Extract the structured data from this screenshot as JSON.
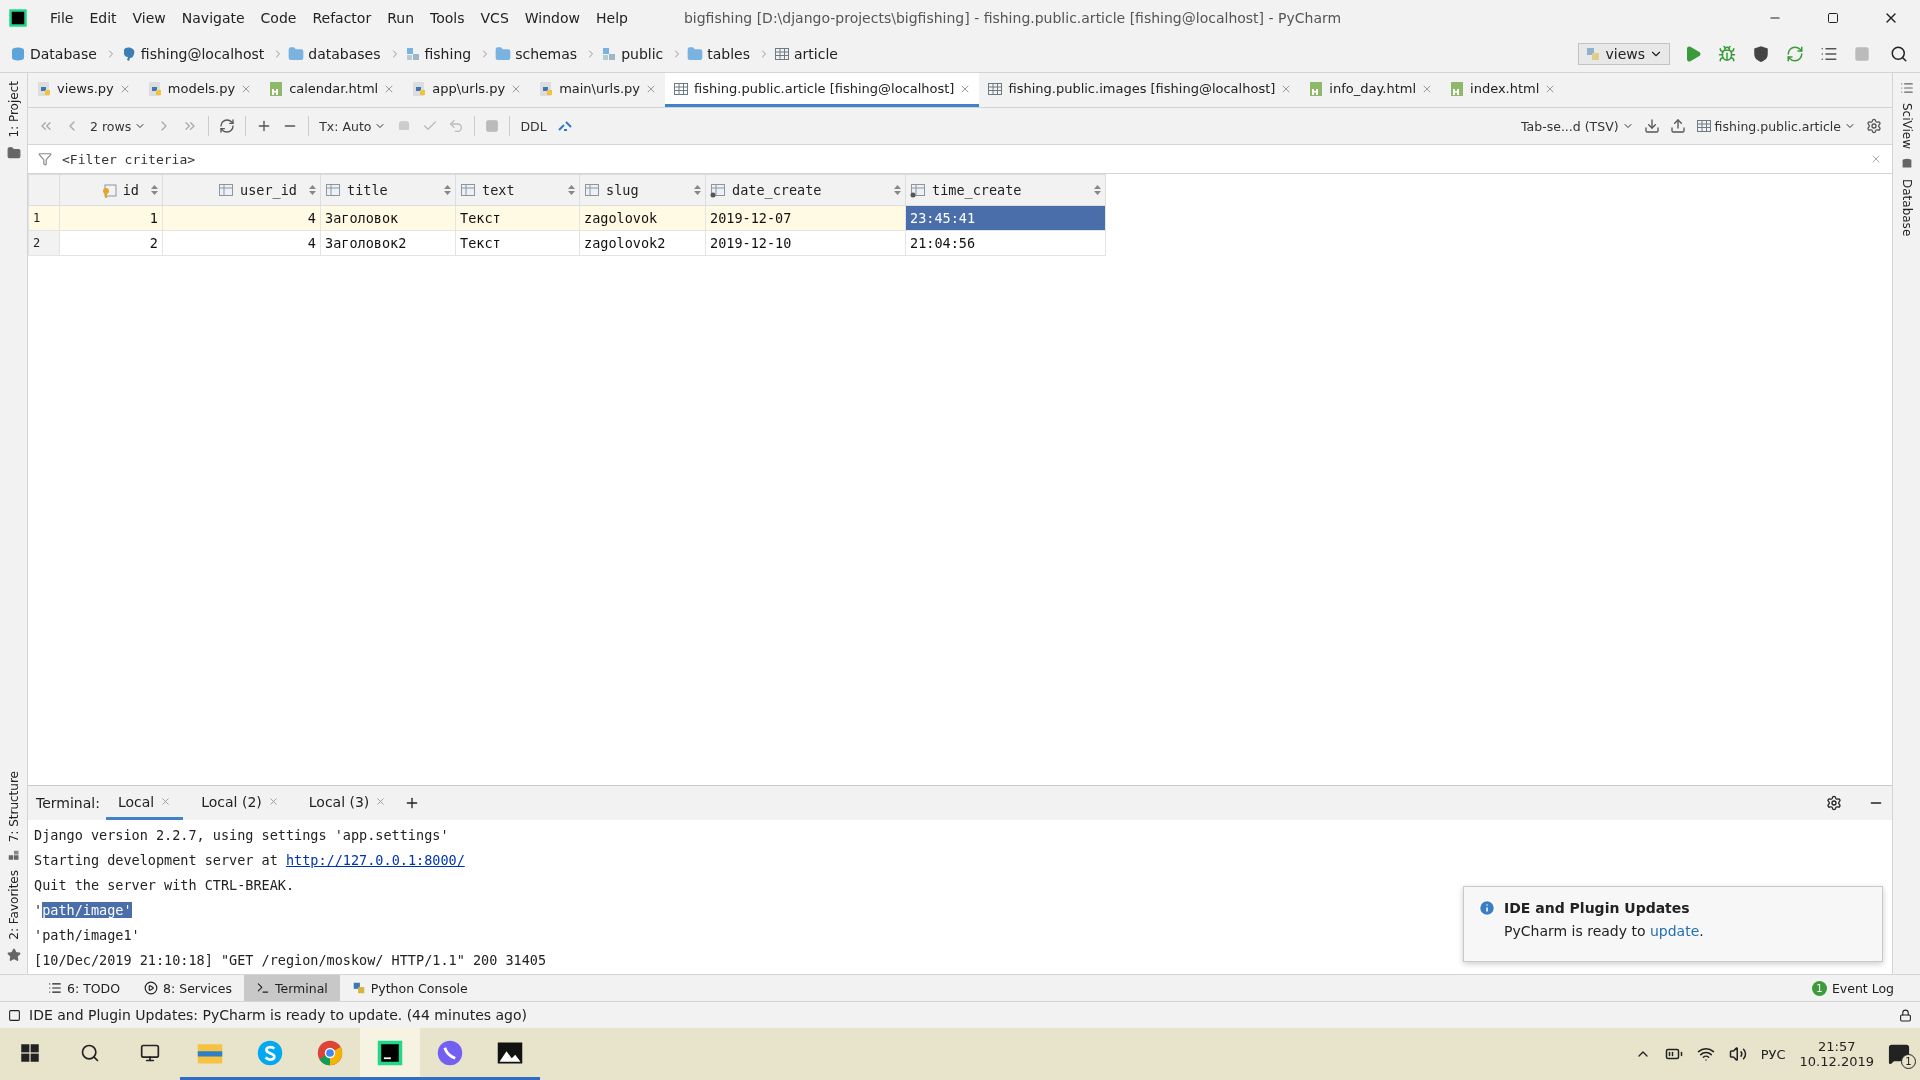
{
  "window": {
    "title": "bigfishing [D:\\django-projects\\bigfishing] - fishing.public.article [fishing@localhost] - PyCharm",
    "menu": [
      "File",
      "Edit",
      "View",
      "Navigate",
      "Code",
      "Refactor",
      "Run",
      "Tools",
      "VCS",
      "Window",
      "Help"
    ]
  },
  "breadcrumb": [
    {
      "label": "Database",
      "kind": "db"
    },
    {
      "label": "fishing@localhost",
      "kind": "conn"
    },
    {
      "label": "databases",
      "kind": "folder"
    },
    {
      "label": "fishing",
      "kind": "schema"
    },
    {
      "label": "schemas",
      "kind": "folder"
    },
    {
      "label": "public",
      "kind": "schema"
    },
    {
      "label": "tables",
      "kind": "folder"
    },
    {
      "label": "article",
      "kind": "table"
    }
  ],
  "run_config": "views",
  "editor_tabs": [
    {
      "label": "views.py",
      "kind": "py",
      "selected": false
    },
    {
      "label": "models.py",
      "kind": "py",
      "selected": false
    },
    {
      "label": "calendar.html",
      "kind": "html",
      "selected": false
    },
    {
      "label": "app\\urls.py",
      "kind": "py",
      "selected": false
    },
    {
      "label": "main\\urls.py",
      "kind": "py",
      "selected": false
    },
    {
      "label": "fishing.public.article [fishing@localhost]",
      "kind": "table",
      "selected": true
    },
    {
      "label": "fishing.public.images [fishing@localhost]",
      "kind": "table",
      "selected": false
    },
    {
      "label": "info_day.html",
      "kind": "html",
      "selected": false
    },
    {
      "label": "index.html",
      "kind": "html",
      "selected": false
    }
  ],
  "data_toolbar": {
    "rows": "2 rows",
    "tx": "Tx: Auto",
    "ddl": "DDL",
    "format": "Tab-se...d (TSV)",
    "target": "fishing.public.article"
  },
  "filter": {
    "placeholder": "<Filter criteria>"
  },
  "table": {
    "columns": [
      {
        "name": "id",
        "kind": "key",
        "numeric": true
      },
      {
        "name": "user_id",
        "kind": "plain",
        "numeric": true
      },
      {
        "name": "title",
        "kind": "plain",
        "numeric": false
      },
      {
        "name": "text",
        "kind": "plain",
        "numeric": false
      },
      {
        "name": "slug",
        "kind": "plain",
        "numeric": false
      },
      {
        "name": "date_create",
        "kind": "date",
        "numeric": false
      },
      {
        "name": "time_create",
        "kind": "date",
        "numeric": false
      }
    ],
    "rows": [
      {
        "number": "1",
        "current": true,
        "cells": [
          {
            "text": "1",
            "selected": false
          },
          {
            "text": "4",
            "selected": false
          },
          {
            "text": "Заголовок",
            "selected": false
          },
          {
            "text": "Текст",
            "selected": false
          },
          {
            "text": "zagolovok",
            "selected": false
          },
          {
            "text": "2019-12-07",
            "selected": false
          },
          {
            "text": "23:45:41",
            "selected": true
          }
        ]
      },
      {
        "number": "2",
        "current": false,
        "cells": [
          {
            "text": "2",
            "selected": false
          },
          {
            "text": "4",
            "selected": false
          },
          {
            "text": "Заголовок2",
            "selected": false
          },
          {
            "text": "Текст",
            "selected": false
          },
          {
            "text": "zagolovok2",
            "selected": false
          },
          {
            "text": "2019-12-10",
            "selected": false
          },
          {
            "text": "21:04:56",
            "selected": false
          }
        ]
      }
    ]
  },
  "terminal": {
    "label": "Terminal:",
    "tabs": [
      {
        "label": "Local",
        "selected": true
      },
      {
        "label": "Local (2)",
        "selected": false
      },
      {
        "label": "Local (3)",
        "selected": false
      }
    ],
    "lines": [
      [
        {
          "text": "Django version 2.2.7, using settings 'app.settings'",
          "kind": "plain"
        }
      ],
      [
        {
          "text": "Starting development server at ",
          "kind": "plain"
        },
        {
          "text": "http://127.0.0.1:8000/",
          "kind": "link"
        }
      ],
      [
        {
          "text": "Quit the server with CTRL-BREAK.",
          "kind": "plain"
        }
      ],
      [
        {
          "text": "'",
          "kind": "plain"
        },
        {
          "text": "path/image'",
          "kind": "selection"
        }
      ],
      [
        {
          "text": "'path/image1'",
          "kind": "plain"
        }
      ],
      [
        {
          "text": "[10/Dec/2019 21:10:18] \"GET /region/moskow/ HTTP/1.1\" 200 31405",
          "kind": "plain"
        }
      ]
    ]
  },
  "notification": {
    "title": "IDE and Plugin Updates",
    "text": "PyCharm is ready to ",
    "link": "update",
    "end": "."
  },
  "tool_windows": [
    {
      "label": "6: TODO",
      "kind": "todo",
      "selected": false
    },
    {
      "label": "8: Services",
      "kind": "services",
      "selected": false
    },
    {
      "label": "Terminal",
      "kind": "terminal",
      "selected": true
    },
    {
      "label": "Python Console",
      "kind": "python",
      "selected": false
    }
  ],
  "event_log": {
    "label": "Event Log",
    "count": "1"
  },
  "status": "IDE and Plugin Updates: PyCharm is ready to update. (44 minutes ago)",
  "side_left": [
    "1: Project",
    "7: Structure",
    "2: Favorites"
  ],
  "side_right": [
    "SciView",
    "Database"
  ],
  "taskbar": {
    "apps": [
      {
        "kind": "explorer",
        "running": true,
        "active": false
      },
      {
        "kind": "skype",
        "running": true,
        "active": false
      },
      {
        "kind": "chrome",
        "running": true,
        "active": false
      },
      {
        "kind": "pycharm",
        "running": true,
        "active": true
      },
      {
        "kind": "viber",
        "running": true,
        "active": false
      },
      {
        "kind": "photos",
        "running": true,
        "active": false
      }
    ],
    "language": "РУС",
    "time": "21:57",
    "date": "10.12.2019",
    "notifications": "1"
  }
}
